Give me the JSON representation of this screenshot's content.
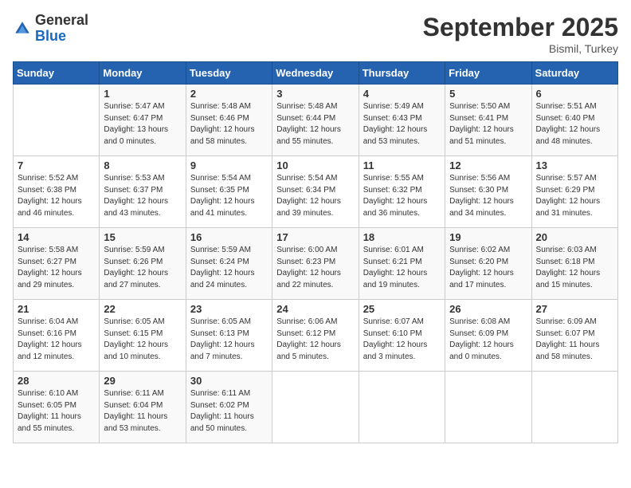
{
  "logo": {
    "line1": "General",
    "line2": "Blue",
    "icon": "▶"
  },
  "header": {
    "month": "September 2025",
    "location": "Bismil, Turkey"
  },
  "weekdays": [
    "Sunday",
    "Monday",
    "Tuesday",
    "Wednesday",
    "Thursday",
    "Friday",
    "Saturday"
  ],
  "weeks": [
    [
      {
        "day": "",
        "sunrise": "",
        "sunset": "",
        "daylight": ""
      },
      {
        "day": "1",
        "sunrise": "Sunrise: 5:47 AM",
        "sunset": "Sunset: 6:47 PM",
        "daylight": "Daylight: 13 hours and 0 minutes."
      },
      {
        "day": "2",
        "sunrise": "Sunrise: 5:48 AM",
        "sunset": "Sunset: 6:46 PM",
        "daylight": "Daylight: 12 hours and 58 minutes."
      },
      {
        "day": "3",
        "sunrise": "Sunrise: 5:48 AM",
        "sunset": "Sunset: 6:44 PM",
        "daylight": "Daylight: 12 hours and 55 minutes."
      },
      {
        "day": "4",
        "sunrise": "Sunrise: 5:49 AM",
        "sunset": "Sunset: 6:43 PM",
        "daylight": "Daylight: 12 hours and 53 minutes."
      },
      {
        "day": "5",
        "sunrise": "Sunrise: 5:50 AM",
        "sunset": "Sunset: 6:41 PM",
        "daylight": "Daylight: 12 hours and 51 minutes."
      },
      {
        "day": "6",
        "sunrise": "Sunrise: 5:51 AM",
        "sunset": "Sunset: 6:40 PM",
        "daylight": "Daylight: 12 hours and 48 minutes."
      }
    ],
    [
      {
        "day": "7",
        "sunrise": "Sunrise: 5:52 AM",
        "sunset": "Sunset: 6:38 PM",
        "daylight": "Daylight: 12 hours and 46 minutes."
      },
      {
        "day": "8",
        "sunrise": "Sunrise: 5:53 AM",
        "sunset": "Sunset: 6:37 PM",
        "daylight": "Daylight: 12 hours and 43 minutes."
      },
      {
        "day": "9",
        "sunrise": "Sunrise: 5:54 AM",
        "sunset": "Sunset: 6:35 PM",
        "daylight": "Daylight: 12 hours and 41 minutes."
      },
      {
        "day": "10",
        "sunrise": "Sunrise: 5:54 AM",
        "sunset": "Sunset: 6:34 PM",
        "daylight": "Daylight: 12 hours and 39 minutes."
      },
      {
        "day": "11",
        "sunrise": "Sunrise: 5:55 AM",
        "sunset": "Sunset: 6:32 PM",
        "daylight": "Daylight: 12 hours and 36 minutes."
      },
      {
        "day": "12",
        "sunrise": "Sunrise: 5:56 AM",
        "sunset": "Sunset: 6:30 PM",
        "daylight": "Daylight: 12 hours and 34 minutes."
      },
      {
        "day": "13",
        "sunrise": "Sunrise: 5:57 AM",
        "sunset": "Sunset: 6:29 PM",
        "daylight": "Daylight: 12 hours and 31 minutes."
      }
    ],
    [
      {
        "day": "14",
        "sunrise": "Sunrise: 5:58 AM",
        "sunset": "Sunset: 6:27 PM",
        "daylight": "Daylight: 12 hours and 29 minutes."
      },
      {
        "day": "15",
        "sunrise": "Sunrise: 5:59 AM",
        "sunset": "Sunset: 6:26 PM",
        "daylight": "Daylight: 12 hours and 27 minutes."
      },
      {
        "day": "16",
        "sunrise": "Sunrise: 5:59 AM",
        "sunset": "Sunset: 6:24 PM",
        "daylight": "Daylight: 12 hours and 24 minutes."
      },
      {
        "day": "17",
        "sunrise": "Sunrise: 6:00 AM",
        "sunset": "Sunset: 6:23 PM",
        "daylight": "Daylight: 12 hours and 22 minutes."
      },
      {
        "day": "18",
        "sunrise": "Sunrise: 6:01 AM",
        "sunset": "Sunset: 6:21 PM",
        "daylight": "Daylight: 12 hours and 19 minutes."
      },
      {
        "day": "19",
        "sunrise": "Sunrise: 6:02 AM",
        "sunset": "Sunset: 6:20 PM",
        "daylight": "Daylight: 12 hours and 17 minutes."
      },
      {
        "day": "20",
        "sunrise": "Sunrise: 6:03 AM",
        "sunset": "Sunset: 6:18 PM",
        "daylight": "Daylight: 12 hours and 15 minutes."
      }
    ],
    [
      {
        "day": "21",
        "sunrise": "Sunrise: 6:04 AM",
        "sunset": "Sunset: 6:16 PM",
        "daylight": "Daylight: 12 hours and 12 minutes."
      },
      {
        "day": "22",
        "sunrise": "Sunrise: 6:05 AM",
        "sunset": "Sunset: 6:15 PM",
        "daylight": "Daylight: 12 hours and 10 minutes."
      },
      {
        "day": "23",
        "sunrise": "Sunrise: 6:05 AM",
        "sunset": "Sunset: 6:13 PM",
        "daylight": "Daylight: 12 hours and 7 minutes."
      },
      {
        "day": "24",
        "sunrise": "Sunrise: 6:06 AM",
        "sunset": "Sunset: 6:12 PM",
        "daylight": "Daylight: 12 hours and 5 minutes."
      },
      {
        "day": "25",
        "sunrise": "Sunrise: 6:07 AM",
        "sunset": "Sunset: 6:10 PM",
        "daylight": "Daylight: 12 hours and 3 minutes."
      },
      {
        "day": "26",
        "sunrise": "Sunrise: 6:08 AM",
        "sunset": "Sunset: 6:09 PM",
        "daylight": "Daylight: 12 hours and 0 minutes."
      },
      {
        "day": "27",
        "sunrise": "Sunrise: 6:09 AM",
        "sunset": "Sunset: 6:07 PM",
        "daylight": "Daylight: 11 hours and 58 minutes."
      }
    ],
    [
      {
        "day": "28",
        "sunrise": "Sunrise: 6:10 AM",
        "sunset": "Sunset: 6:05 PM",
        "daylight": "Daylight: 11 hours and 55 minutes."
      },
      {
        "day": "29",
        "sunrise": "Sunrise: 6:11 AM",
        "sunset": "Sunset: 6:04 PM",
        "daylight": "Daylight: 11 hours and 53 minutes."
      },
      {
        "day": "30",
        "sunrise": "Sunrise: 6:11 AM",
        "sunset": "Sunset: 6:02 PM",
        "daylight": "Daylight: 11 hours and 50 minutes."
      },
      {
        "day": "",
        "sunrise": "",
        "sunset": "",
        "daylight": ""
      },
      {
        "day": "",
        "sunrise": "",
        "sunset": "",
        "daylight": ""
      },
      {
        "day": "",
        "sunrise": "",
        "sunset": "",
        "daylight": ""
      },
      {
        "day": "",
        "sunrise": "",
        "sunset": "",
        "daylight": ""
      }
    ]
  ]
}
